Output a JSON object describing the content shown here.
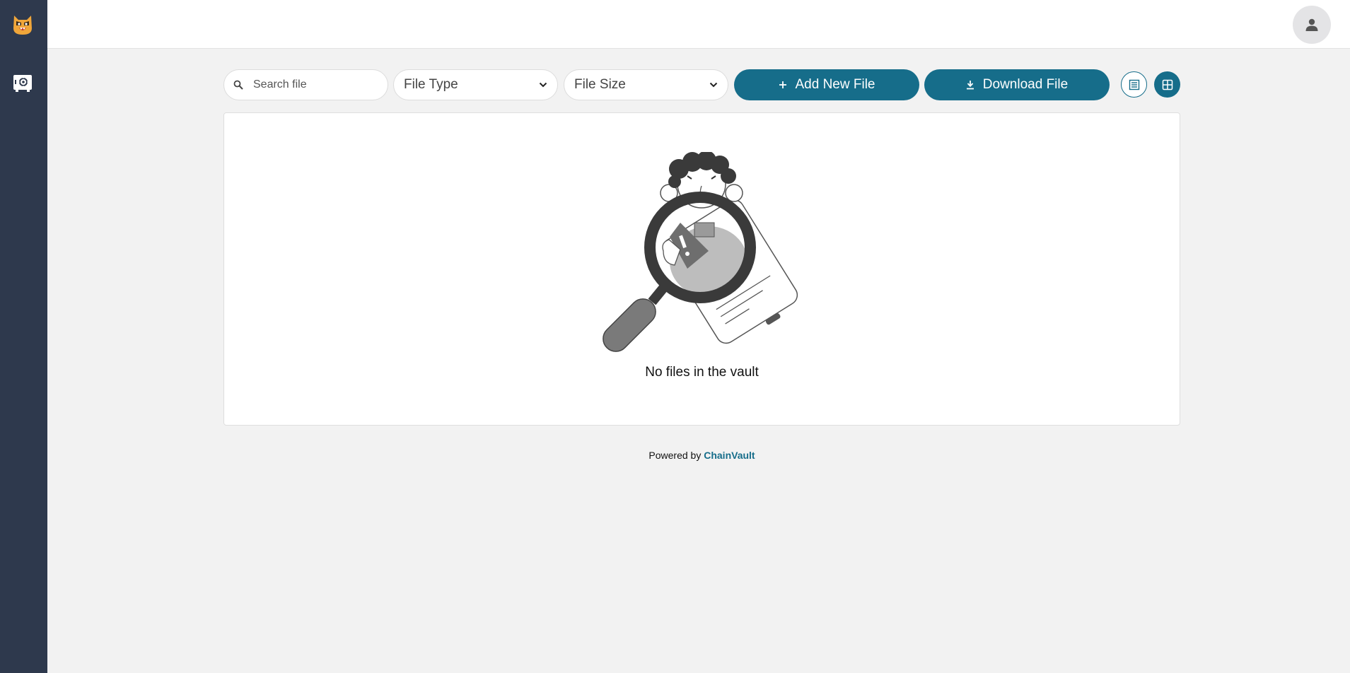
{
  "sidebar": {
    "logo_icon": "cat-logo-icon",
    "items": [
      {
        "icon": "vault-settings-icon"
      }
    ]
  },
  "header": {
    "avatar_icon": "user-icon"
  },
  "toolbar": {
    "search_placeholder": "Search file",
    "file_type_label": "File Type",
    "file_size_label": "File Size",
    "add_label": "Add New File",
    "download_label": "Download File",
    "view_modes": [
      "list",
      "grid"
    ],
    "active_view": "grid"
  },
  "empty_state": {
    "message": "No files in the vault"
  },
  "footer": {
    "prefix": "Powered by",
    "brand": "ChainVault"
  },
  "colors": {
    "accent": "#166d8a",
    "sidebar": "#2e394d",
    "background": "#f2f2f2",
    "logo": "#f0a63a"
  }
}
